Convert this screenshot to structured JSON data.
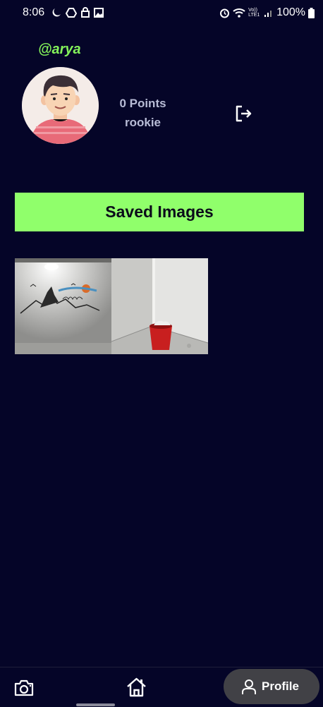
{
  "status_bar": {
    "time": "8:06",
    "left_icons": [
      "moon-crescent-icon",
      "drive-icon",
      "lock-icon",
      "image-icon"
    ],
    "right_icons": [
      "alarm-icon",
      "wifi-icon",
      "volte-icon",
      "signal-icon",
      "battery-icon"
    ],
    "volte_label": "Vo)) LTE1",
    "battery_percent": "100%"
  },
  "profile": {
    "username": "@arya",
    "points_label": "0 Points",
    "rank": "rookie",
    "avatar_icon": "user-avatar-illustration"
  },
  "saved": {
    "header_label": "Saved Images",
    "images": [
      {
        "icon": "wall-art-photo"
      },
      {
        "icon": "red-bucket-photo"
      }
    ]
  },
  "actions": {
    "logout_icon": "logout-icon"
  },
  "bottom_nav": {
    "items": [
      {
        "icon": "camera-icon"
      },
      {
        "icon": "home-icon"
      },
      {
        "icon": "profile-icon",
        "label": "Profile",
        "active": true
      }
    ]
  },
  "colors": {
    "background": "#050528",
    "accent_green": "#90ff6b",
    "username_green": "#84f25a",
    "muted_text": "#b8bcd6",
    "active_nav_bg": "#414146"
  }
}
